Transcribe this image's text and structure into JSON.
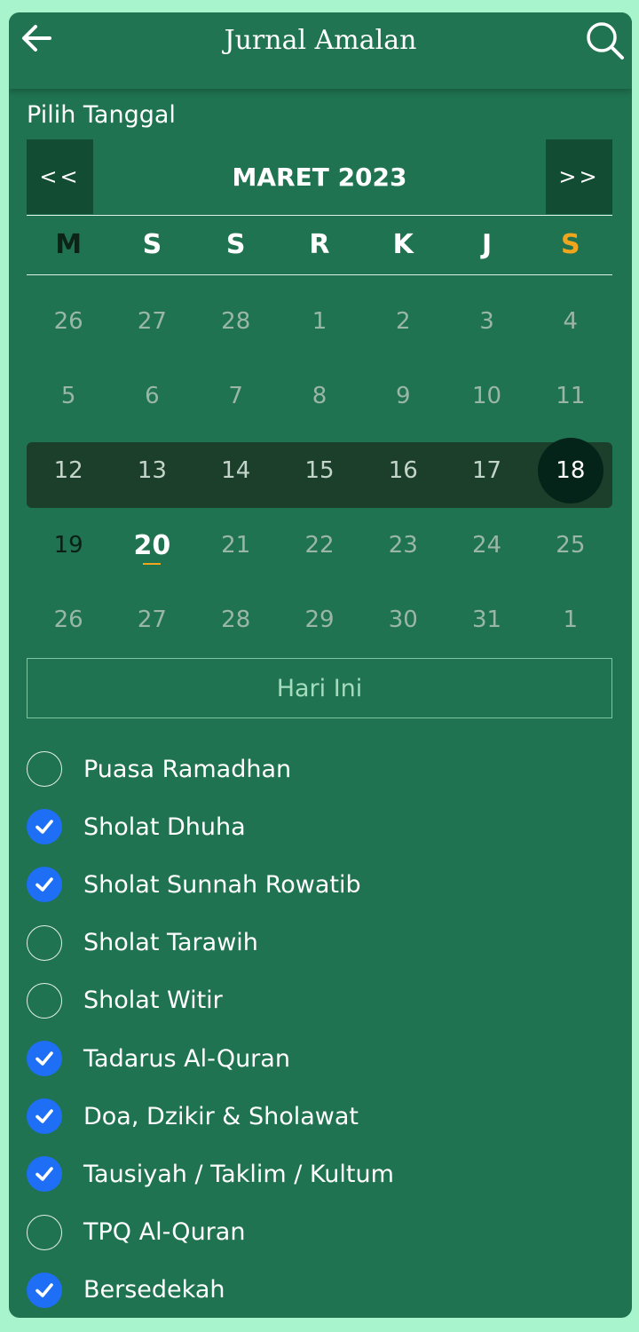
{
  "header": {
    "title": "Jurnal Amalan",
    "back_icon": "arrow-left-icon",
    "search_icon": "search-icon"
  },
  "calendar": {
    "label": "Pilih Tanggal",
    "prev_label": "<<",
    "next_label": ">>",
    "month_title": "MARET 2023",
    "weekdays": [
      "M",
      "S",
      "S",
      "R",
      "K",
      "J",
      "S"
    ],
    "weekday_colors": [
      "#0b2417",
      "#ffffff",
      "#ffffff",
      "#ffffff",
      "#ffffff",
      "#ffffff",
      "#f0a51f"
    ],
    "weeks": [
      [
        "26",
        "27",
        "28",
        "1",
        "2",
        "3",
        "4"
      ],
      [
        "5",
        "6",
        "7",
        "8",
        "9",
        "10",
        "11"
      ],
      [
        "12",
        "13",
        "14",
        "15",
        "16",
        "17",
        "18"
      ],
      [
        "19",
        "20",
        "21",
        "22",
        "23",
        "24",
        "25"
      ],
      [
        "26",
        "27",
        "28",
        "29",
        "30",
        "31",
        "1"
      ]
    ],
    "selected_date": "18",
    "today_date": "20",
    "today_button": "Hari Ini",
    "accent_color": "#f0a51f"
  },
  "tasks": [
    {
      "label": "Puasa Ramadhan",
      "checked": false
    },
    {
      "label": "Sholat Dhuha",
      "checked": true
    },
    {
      "label": "Sholat Sunnah Rowatib",
      "checked": true
    },
    {
      "label": "Sholat Tarawih",
      "checked": false
    },
    {
      "label": "Sholat Witir",
      "checked": false
    },
    {
      "label": "Tadarus Al-Quran",
      "checked": true
    },
    {
      "label": "Doa, Dzikir & Sholawat",
      "checked": true
    },
    {
      "label": "Tausiyah / Taklim / Kultum",
      "checked": true
    },
    {
      "label": "TPQ Al-Quran",
      "checked": false
    },
    {
      "label": "Bersedekah",
      "checked": true
    }
  ],
  "colors": {
    "background": "#a8f4cc",
    "card": "#1f7350",
    "check_on": "#1e6ff5"
  }
}
